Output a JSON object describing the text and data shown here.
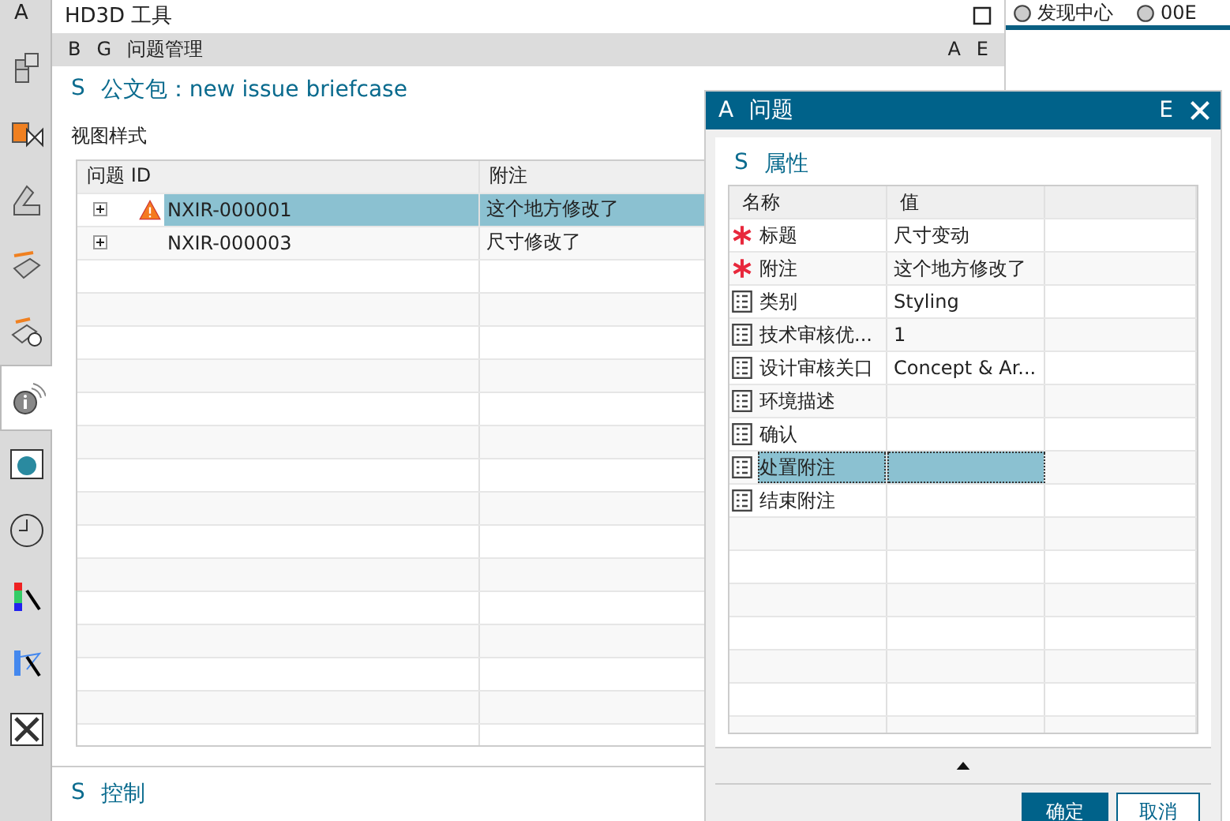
{
  "sidebar": {
    "label": "A",
    "items": [
      {
        "selected": false
      },
      {
        "selected": false
      },
      {
        "selected": false
      },
      {
        "selected": false
      },
      {
        "selected": false
      },
      {
        "selected": true
      },
      {
        "selected": false
      },
      {
        "selected": false
      },
      {
        "selected": false
      },
      {
        "selected": false
      },
      {
        "selected": false
      }
    ]
  },
  "panel": {
    "title": "HD3D 工具",
    "header": {
      "keys": [
        "B",
        "G"
      ],
      "title": "问题管理",
      "actions": [
        "A",
        "E"
      ]
    },
    "briefcase": {
      "key": "S",
      "title": "公文包：new issue briefcase"
    },
    "view_label": "视图样式",
    "table": {
      "columns": [
        "问题 ID",
        "附注"
      ],
      "rows": [
        {
          "id": "NXIR-000001",
          "note": "这个地方修改了",
          "warning": true,
          "expanded": false,
          "selected": true
        },
        {
          "id": "NXIR-000003",
          "note": "尺寸修改了",
          "warning": false,
          "expanded": false,
          "selected": false
        }
      ]
    },
    "footer": {
      "key": "S",
      "title": "控制"
    }
  },
  "top_tabs": [
    {
      "label": "发现中心"
    },
    {
      "label": "00E"
    }
  ],
  "dialog": {
    "key": "A",
    "title": "问题",
    "actions": [
      "E"
    ],
    "section": {
      "key": "S",
      "title": "属性"
    },
    "columns": [
      "名称",
      "值"
    ],
    "properties": [
      {
        "kind": "required",
        "name": "标题",
        "value": "尺寸变动",
        "selected": false
      },
      {
        "kind": "required",
        "name": "附注",
        "value": "这个地方修改了",
        "selected": false
      },
      {
        "kind": "field",
        "name": "类别",
        "value": "Styling",
        "selected": false
      },
      {
        "kind": "field",
        "name": "技术审核优...",
        "value": "1",
        "selected": false
      },
      {
        "kind": "field",
        "name": "设计审核关口",
        "value": "Concept & Ar...",
        "selected": false
      },
      {
        "kind": "field",
        "name": "环境描述",
        "selected": false
      },
      {
        "kind": "field",
        "name": "确认",
        "selected": false
      },
      {
        "kind": "field",
        "name": "处置附注",
        "selected": true
      },
      {
        "kind": "field",
        "name": "结束附注",
        "selected": false
      }
    ],
    "buttons": [
      {
        "label": "确定",
        "primary": true
      },
      {
        "label": "取消",
        "primary": false
      }
    ]
  }
}
